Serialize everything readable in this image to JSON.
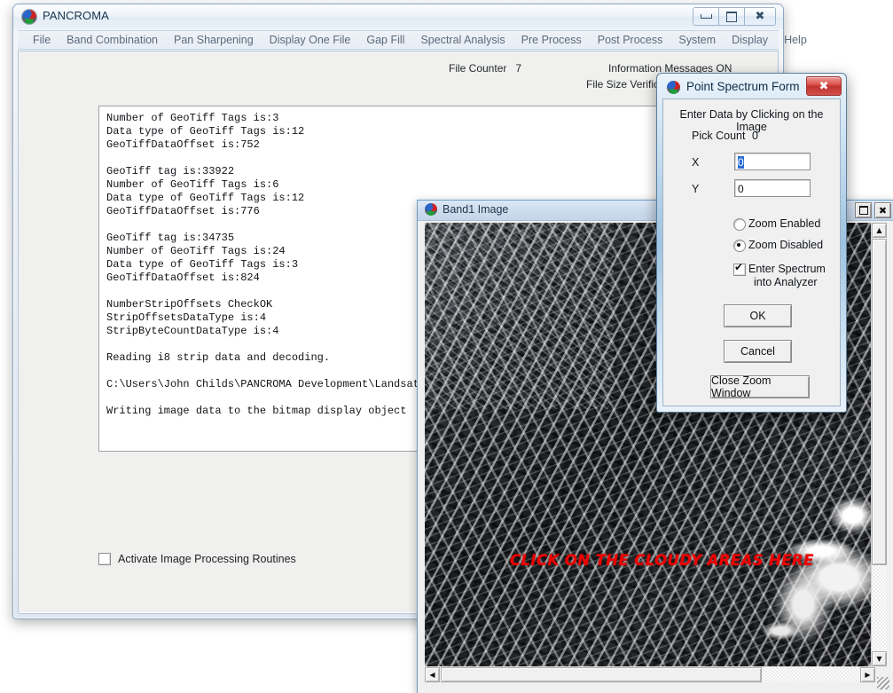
{
  "main_window": {
    "title": "PANCROMA",
    "icon": "pancroma-logo-icon",
    "controls": {
      "minimize": "Minimize",
      "maximize": "Maximize",
      "close": "Close"
    },
    "menu": [
      "File",
      "Band Combination",
      "Pan Sharpening",
      "Display One File",
      "Gap Fill",
      "Spectral Analysis",
      "Pre Process",
      "Post Process",
      "System",
      "Display",
      "Help"
    ],
    "status": {
      "file_counter_label": "File Counter",
      "file_counter_value": "7",
      "information_messages": "Information  Messages ON",
      "file_size_verification": "File Size Verificatio"
    },
    "console_lines": [
      {
        "label": "Number of GeoTiff Tags is:",
        "value": "3"
      },
      {
        "label": "Data type of GeoTiff Tags is:",
        "value": "12"
      },
      {
        "label": "GeoTiffDataOffset is:",
        "value": "752"
      },
      {
        "label": "",
        "value": ""
      },
      {
        "label": "GeoTiff tag is:",
        "value": "33922"
      },
      {
        "label": "Number of GeoTiff Tags is:",
        "value": "6"
      },
      {
        "label": "Data type of GeoTiff Tags is:",
        "value": "12"
      },
      {
        "label": "GeoTiffDataOffset is:",
        "value": "776"
      },
      {
        "label": "",
        "value": ""
      },
      {
        "label": "GeoTiff tag is:",
        "value": "34735"
      },
      {
        "label": "Number of GeoTiff Tags is:",
        "value": "24"
      },
      {
        "label": "Data type of GeoTiff Tags is:",
        "value": "3"
      },
      {
        "label": "GeoTiffDataOffset is:",
        "value": "824"
      },
      {
        "label": "",
        "value": ""
      },
      {
        "label": "NumberStripOffsets Check",
        "value": "OK"
      },
      {
        "label": "StripOffsetsDataType is:",
        "value": "4"
      },
      {
        "label": "StripByteCountDataType is:",
        "value": "4"
      },
      {
        "label": "",
        "value": ""
      },
      {
        "label": "Reading i8 strip data and decoding.",
        "value": ""
      },
      {
        "label": "",
        "value": ""
      },
      {
        "label": "C:\\Users\\John Childs\\PANCROMA Development\\Landsat Ti",
        "value": ""
      },
      {
        "label": "",
        "value": ""
      },
      {
        "label": "Writing image data to the bitmap display object",
        "value": ""
      }
    ],
    "activate_checkbox": {
      "label": "Activate Image Processing Routines",
      "checked": false
    }
  },
  "band_window": {
    "title": "Band1 Image",
    "icon": "pancroma-logo-icon",
    "controls": {
      "maximize": "Maximize",
      "close": "Close"
    },
    "overlay_text": "CLICK ON THE CLOUDY AREAS HERE",
    "overlay_color": "#ee0000",
    "scroll": {
      "vertical_thumb_percent": 80,
      "horizontal_thumb_percent": 75,
      "up_arrow": "▲",
      "down_arrow": "▼",
      "left_arrow": "◀",
      "right_arrow": "▶"
    }
  },
  "point_spectrum_form": {
    "title": "Point Spectrum Form",
    "icon": "pancroma-logo-icon",
    "close_label": "✖",
    "heading": "Enter Data by Clicking on the Image",
    "pick_count_label": "Pick Count",
    "pick_count_value": "0",
    "fields": [
      {
        "label": "X",
        "value": "0",
        "selected": true
      },
      {
        "label": "Y",
        "value": "0",
        "selected": false
      }
    ],
    "radios": [
      {
        "label": "Zoom Enabled",
        "selected": false
      },
      {
        "label": "Zoom Disabled",
        "selected": true
      }
    ],
    "checkbox": {
      "line1": "Enter Spectrum",
      "line2": "into Analyzer",
      "checked": true
    },
    "buttons": [
      {
        "name": "ok",
        "label": "OK"
      },
      {
        "name": "cancel",
        "label": "Cancel"
      },
      {
        "name": "close-zoom-window",
        "label": "Close Zoom Window"
      }
    ]
  }
}
